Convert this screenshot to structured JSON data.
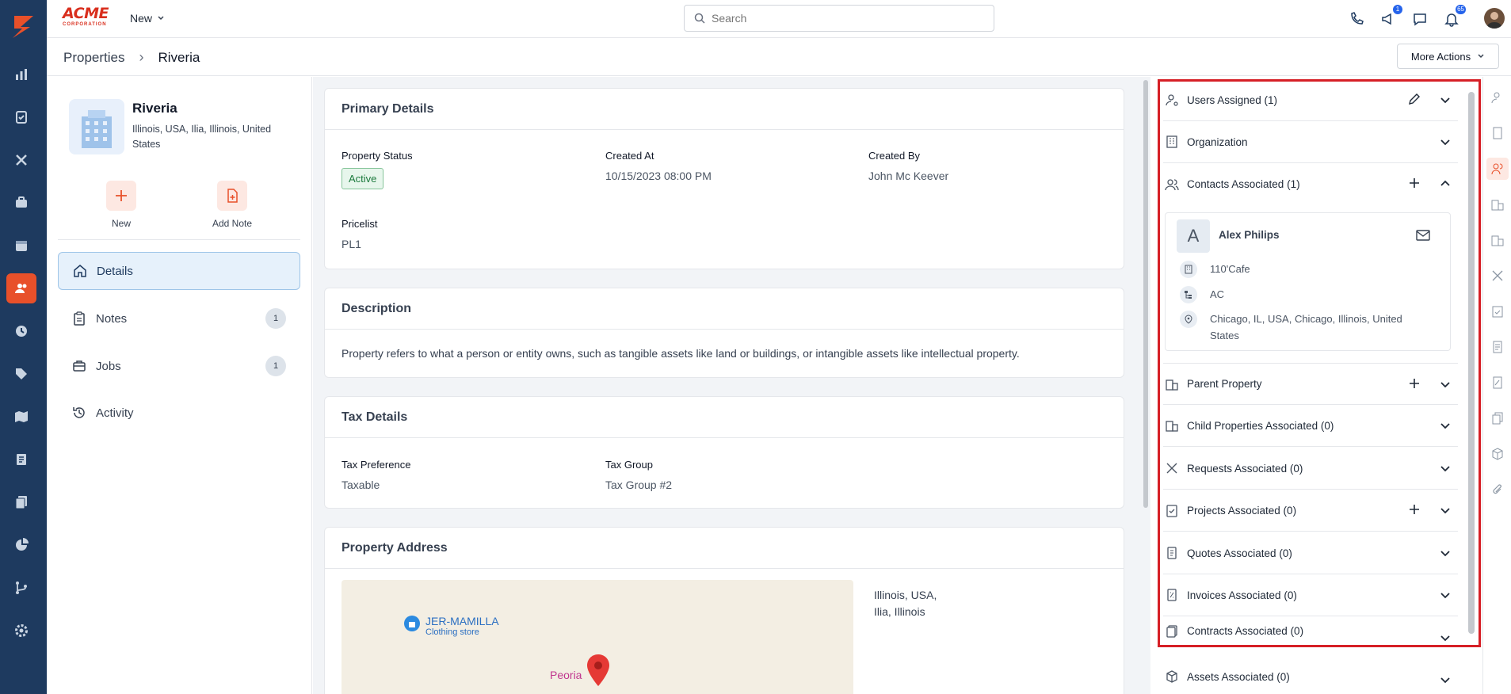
{
  "app": {
    "brand_top": "ACME",
    "brand_bottom": "CORPORATION",
    "new_menu": "New",
    "search_placeholder": "Search",
    "badges": {
      "announcements": "1",
      "notifications": "65"
    }
  },
  "breadcrumb": {
    "root": "Properties",
    "current": "Riveria",
    "more_actions": "More Actions"
  },
  "property": {
    "name": "Riveria",
    "address": "Illinois, USA, Ilia, Illinois, United States",
    "actions": {
      "new": "New",
      "add_note": "Add Note"
    }
  },
  "nav": [
    {
      "label": "Details",
      "count": ""
    },
    {
      "label": "Notes",
      "count": "1"
    },
    {
      "label": "Jobs",
      "count": "1"
    },
    {
      "label": "Activity",
      "count": ""
    }
  ],
  "primary": {
    "title": "Primary Details",
    "status_label": "Property Status",
    "status_value": "Active",
    "created_at_label": "Created At",
    "created_at_value": "10/15/2023 08:00 PM",
    "created_by_label": "Created By",
    "created_by_value": "John Mc Keever",
    "pricelist_label": "Pricelist",
    "pricelist_value": "PL1"
  },
  "description": {
    "title": "Description",
    "text": "Property refers to what a person or entity owns, such as tangible assets like land or buildings, or intangible assets like intellectual property."
  },
  "tax": {
    "title": "Tax Details",
    "pref_label": "Tax Preference",
    "pref_value": "Taxable",
    "group_label": "Tax Group",
    "group_value": "Tax Group #2"
  },
  "address": {
    "title": "Property Address",
    "line1": "Illinois, USA,",
    "line2": "Ilia, Illinois",
    "map_poi_name": "JER-MAMILLA",
    "map_poi_type": "Clothing store",
    "map_city": "Peoria"
  },
  "right_panel": {
    "users": "Users Assigned (1)",
    "organization": "Organization",
    "contacts": "Contacts Associated (1)",
    "contact": {
      "initial": "A",
      "name": "Alex Philips",
      "company": "110'Cafe",
      "code": "AC",
      "location": "Chicago, IL, USA, Chicago, Illinois, United States"
    },
    "parent": "Parent Property",
    "child": "Child Properties Associated (0)",
    "requests": "Requests Associated (0)",
    "projects": "Projects Associated (0)",
    "quotes": "Quotes Associated (0)",
    "invoices": "Invoices Associated (0)",
    "contracts": "Contracts Associated (0)",
    "assets": "Assets Associated (0)"
  },
  "colors": {
    "rail": "#1e3a5f",
    "accent": "#e8502a",
    "highlight": "#d61f26"
  }
}
